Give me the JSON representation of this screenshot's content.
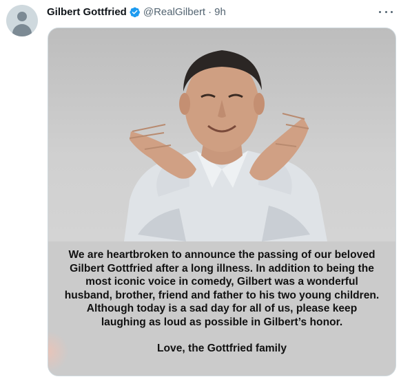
{
  "tweet": {
    "author": {
      "display_name": "Gilbert Gottfried",
      "handle": "@RealGilbert",
      "verified": true,
      "avatar_icon": "default-avatar-icon"
    },
    "separator": "·",
    "time": "9h",
    "more_icon": "ellipsis-icon",
    "colors": {
      "verified": "#1d9bf0",
      "name": "#0f1419",
      "meta": "#536471"
    },
    "media": {
      "caption_lines": [
        "We are heartbroken to announce the passing of our beloved",
        "Gilbert Gottfried after a long illness.  In addition to being the",
        "most iconic voice in comedy, Gilbert was a wonderful",
        "husband, brother, friend and father to his two young children.",
        "Although today is a sad day for all of us, please keep",
        "laughing as loud as possible in Gilbert’s honor."
      ],
      "signoff": "Love, the Gottfried family"
    }
  }
}
